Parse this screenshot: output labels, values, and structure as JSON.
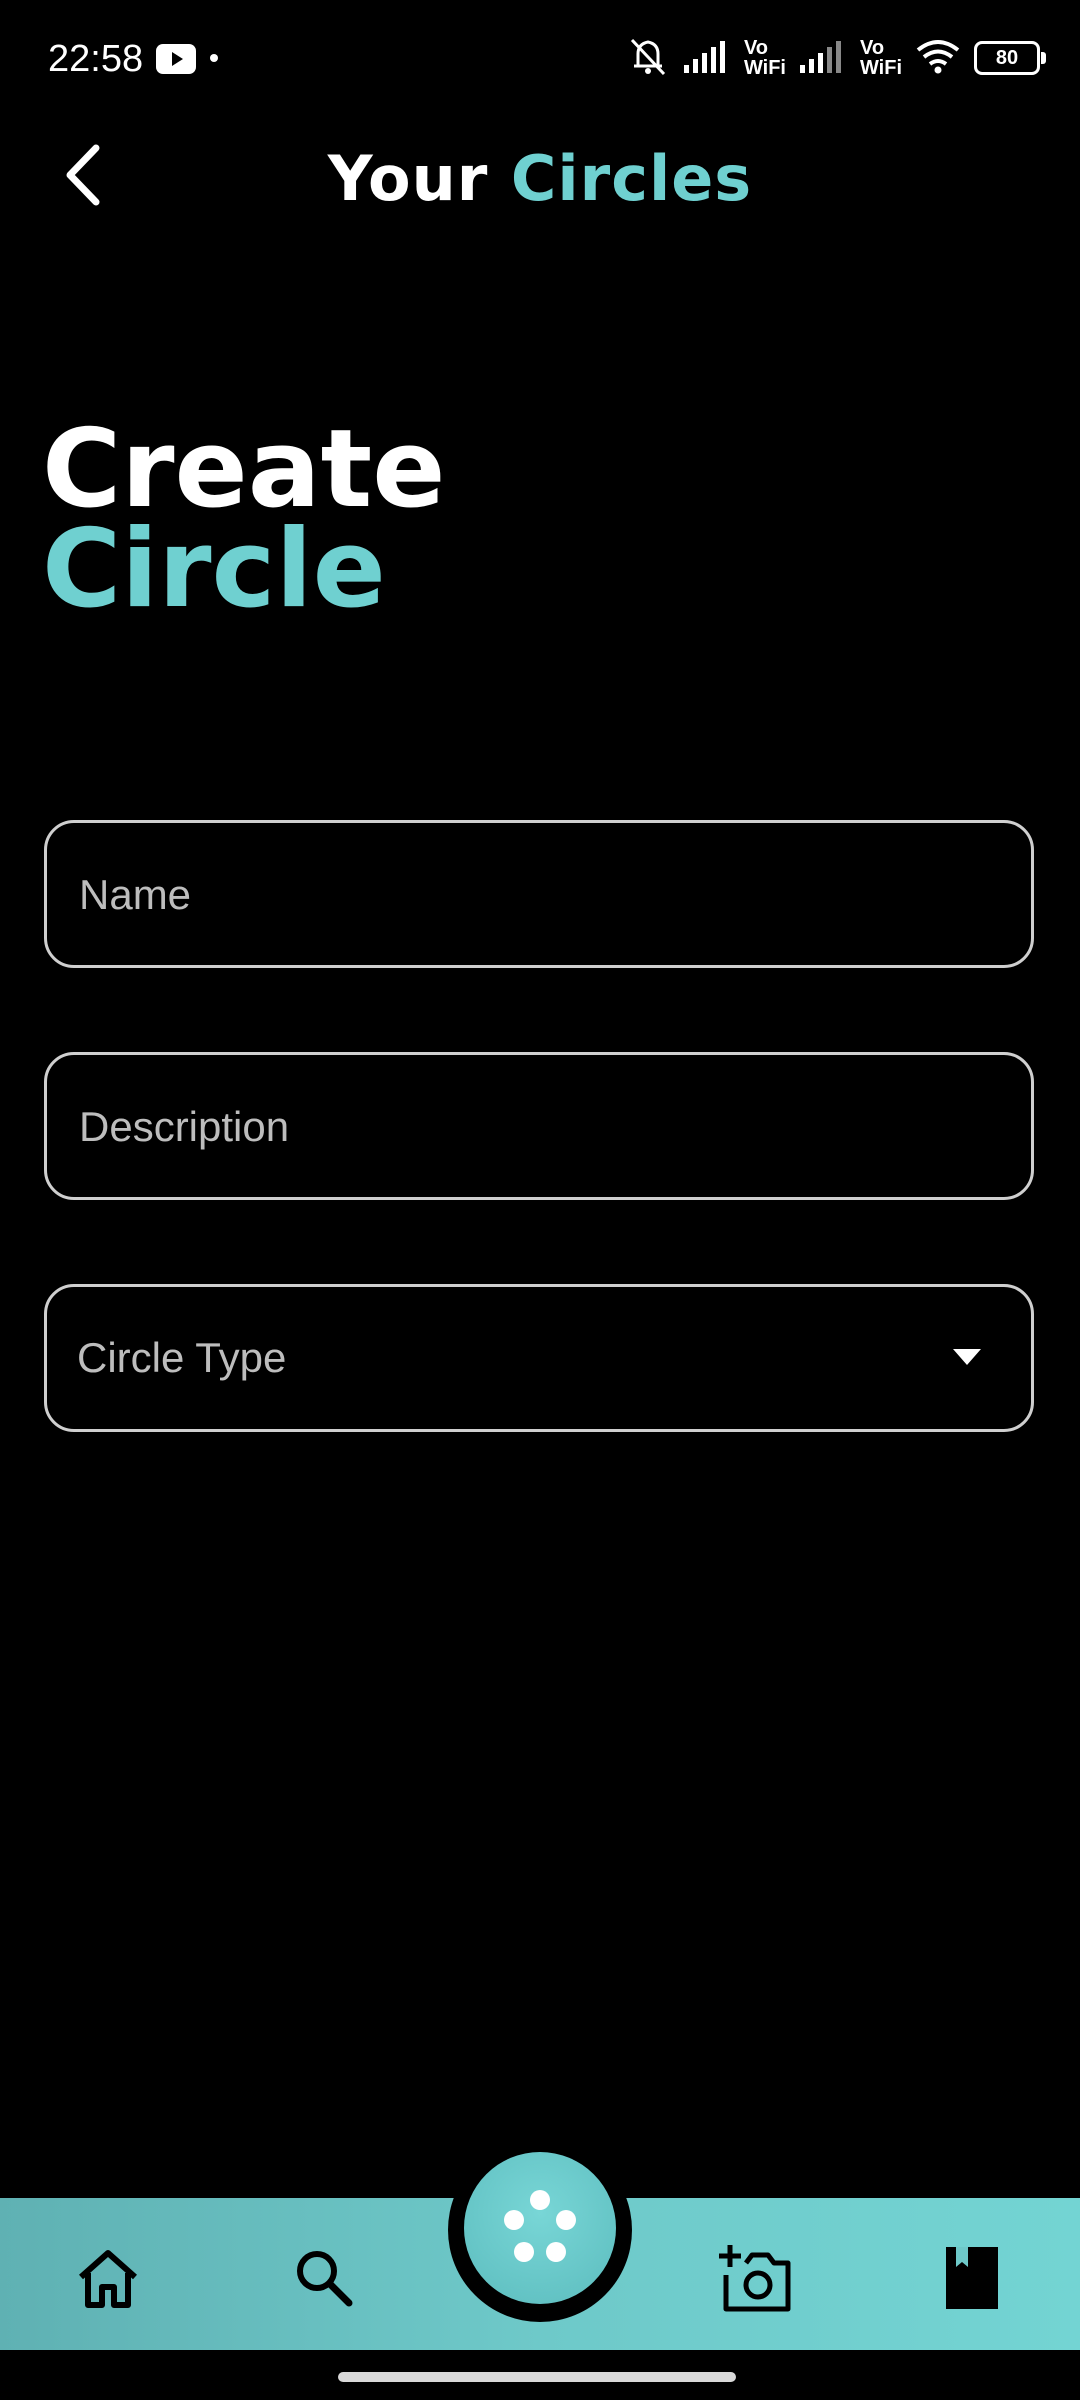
{
  "status_bar": {
    "time": "22:58",
    "vowifi_1": "Vo\nWiFi",
    "vowifi_2": "Vo\nWiFi",
    "battery": "80"
  },
  "header": {
    "title_part1": "Your",
    "title_part2": "Circles"
  },
  "heading": {
    "line1": "Create",
    "line2": "Circle"
  },
  "form": {
    "name_placeholder": "Name",
    "description_placeholder": "Description",
    "circle_type_label": "Circle Type"
  },
  "bottom_nav": {
    "items": [
      "home-icon",
      "search-icon",
      "circles-icon",
      "add-photo-icon",
      "bookmark-icon"
    ]
  },
  "colors": {
    "accent": "#6fd0d0",
    "background": "#000000",
    "nav_gradient_start": "#5fb1b3",
    "nav_gradient_end": "#73d4d3"
  }
}
